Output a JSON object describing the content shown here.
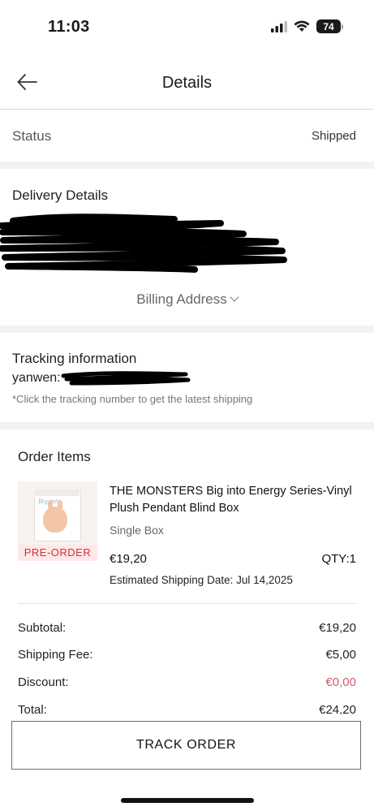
{
  "status_bar": {
    "time": "11:03",
    "battery": "74"
  },
  "nav": {
    "title": "Details"
  },
  "order_status": {
    "label": "Status",
    "value": "Shipped"
  },
  "delivery": {
    "title": "Delivery Details",
    "billing_label": "Billing Address"
  },
  "tracking": {
    "title": "Tracking information",
    "carrier_prefix": "yanwen:",
    "note": "*Click the tracking number to get the latest shipping"
  },
  "order_items": {
    "title": "Order Items",
    "items": [
      {
        "name": "THE MONSTERS Big into Energy Series-Vinyl Plush Pendant Blind Box",
        "variant": "Single Box",
        "price": "€19,20",
        "qty": "QTY:1",
        "shipping_date": "Estimated Shipping Date: Jul 14,2025",
        "badge": "PRE-ORDER"
      }
    ]
  },
  "summary": {
    "subtotal_label": "Subtotal:",
    "subtotal_value": "€19,20",
    "shipping_label": "Shipping Fee:",
    "shipping_value": "€5,00",
    "discount_label": "Discount:",
    "discount_value": "€0,00",
    "total_label": "Total:",
    "total_value": "€24,20"
  },
  "actions": {
    "track_order": "TRACK ORDER"
  },
  "colors": {
    "accent_red": "#d32f3a",
    "discount_red": "#d05d6e",
    "section_gap": "#f2f2f2"
  }
}
